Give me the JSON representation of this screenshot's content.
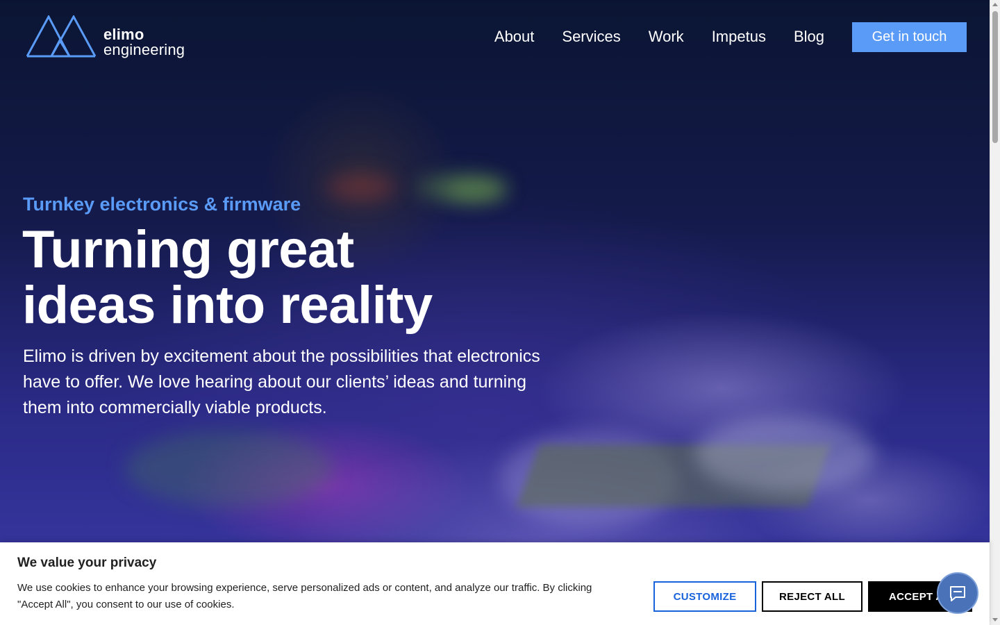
{
  "brand": {
    "name": "elimo",
    "subname": "engineering"
  },
  "nav": {
    "items": [
      "About",
      "Services",
      "Work",
      "Impetus",
      "Blog"
    ],
    "cta": "Get in touch"
  },
  "hero": {
    "eyebrow": "Turnkey electronics & firmware",
    "headline_line1": "Turning great",
    "headline_line2": "ideas into reality",
    "lead": "Elimo is driven by excitement about the possibilities that electronics have to offer. We love hearing about our clients’ ideas and turning them into commercially viable products."
  },
  "cookie": {
    "title": "We value your privacy",
    "text": "We use cookies to enhance your browsing experience, serve personalized ads or content, and analyze our traffic. By clicking \"Accept All\", you consent to our use of cookies.",
    "customize_label": "CUSTOMIZE",
    "reject_label": "REJECT ALL",
    "accept_label": "ACCEPT ALL"
  },
  "colors": {
    "accent": "#5b9bf8",
    "cookie_customize": "#1863dc",
    "hero_dark": "#0d1535"
  },
  "icons": {
    "logo": "mountains-logo-icon",
    "chat": "chat-bubble-icon"
  }
}
